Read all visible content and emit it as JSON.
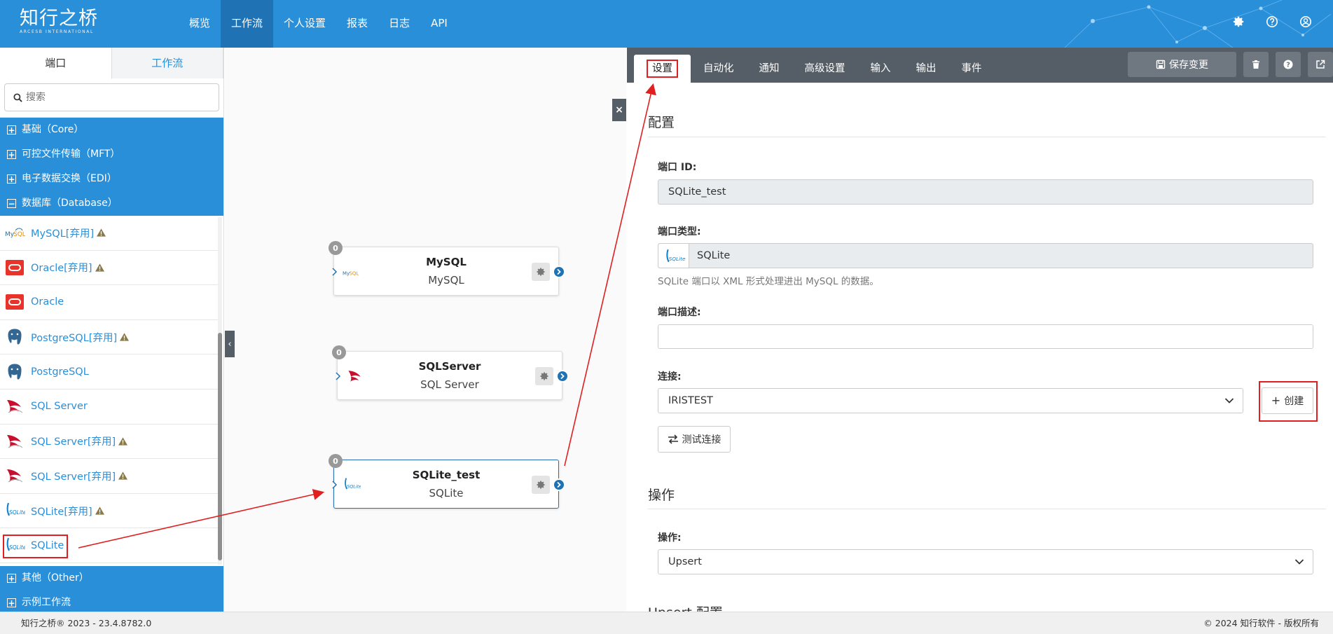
{
  "brand": {
    "name": "知行之桥",
    "sub": "ARCESB INTERNATIONAL"
  },
  "nav": {
    "items": [
      {
        "label": "概览"
      },
      {
        "label": "工作流"
      },
      {
        "label": "个人设置"
      },
      {
        "label": "报表"
      },
      {
        "label": "日志"
      },
      {
        "label": "API"
      }
    ],
    "active": "工作流",
    "icons": [
      "gear-icon",
      "help-icon",
      "user-icon"
    ]
  },
  "sidebar": {
    "tabs": [
      {
        "label": "端口"
      },
      {
        "label": "工作流"
      }
    ],
    "search_placeholder": "搜索",
    "categories": {
      "core": "基础（Core）",
      "mft": "可控文件传输（MFT）",
      "edi": "电子数据交换（EDI）",
      "database": "数据库（Database）",
      "other": "其他（Other）",
      "examples": "示例工作流"
    },
    "items": [
      {
        "label": "MySQL[弃用]",
        "icon": "mysql-icon",
        "deprecated": true
      },
      {
        "label": "Oracle[弃用]",
        "icon": "oracle-icon",
        "deprecated": true
      },
      {
        "label": "Oracle",
        "icon": "oracle-icon",
        "deprecated": false
      },
      {
        "label": "PostgreSQL[弃用]",
        "icon": "postgresql-icon",
        "deprecated": true
      },
      {
        "label": "PostgreSQL",
        "icon": "postgresql-icon",
        "deprecated": false
      },
      {
        "label": "SQL Server",
        "icon": "sqlserver-icon",
        "deprecated": false
      },
      {
        "label": "SQL Server[弃用]",
        "icon": "sqlserver-icon",
        "deprecated": true
      },
      {
        "label": "SQL Server[弃用]",
        "icon": "sqlserver-icon",
        "deprecated": true
      },
      {
        "label": "SQLite[弃用]",
        "icon": "sqlite-icon",
        "deprecated": true
      },
      {
        "label": "SQLite",
        "icon": "sqlite-icon",
        "deprecated": false
      }
    ]
  },
  "canvas": {
    "nodes": [
      {
        "title": "MySQL",
        "subtitle": "MySQL",
        "badge": "0",
        "icon": "mysql-icon"
      },
      {
        "title": "SQLServer",
        "subtitle": "SQL Server",
        "badge": "0",
        "icon": "sqlserver-icon"
      },
      {
        "title": "SQLite_test",
        "subtitle": "SQLite",
        "badge": "0",
        "icon": "sqlite-icon"
      }
    ]
  },
  "panel": {
    "tabs": [
      {
        "label": "设置"
      },
      {
        "label": "自动化"
      },
      {
        "label": "通知"
      },
      {
        "label": "高级设置"
      },
      {
        "label": "输入"
      },
      {
        "label": "输出"
      },
      {
        "label": "事件"
      }
    ],
    "save_label": "保存变更",
    "sections": {
      "config": "配置",
      "operation": "操作",
      "upsert_cut": "Upsert 配置"
    },
    "fields": {
      "port_id_label": "端口 ID:",
      "port_id_value": "SQLite_test",
      "port_type_label": "端口类型:",
      "port_type_value": "SQLite",
      "port_type_help": "SQLite 端口以 XML 形式处理进出 MySQL 的数据。",
      "port_desc_label": "端口描述:",
      "port_desc_value": "",
      "connection_label": "连接:",
      "connection_value": "IRISTEST",
      "create_label": "创建",
      "test_label": "测试连接",
      "action_label": "操作:",
      "action_value": "Upsert"
    }
  },
  "footer": {
    "left": "知行之桥® 2023 - 23.4.8782.0",
    "right": "© 2024 知行软件 - 版权所有"
  },
  "colors": {
    "primary": "#2a8fd9",
    "dark": "#555e66",
    "highlight": "#e02020"
  }
}
